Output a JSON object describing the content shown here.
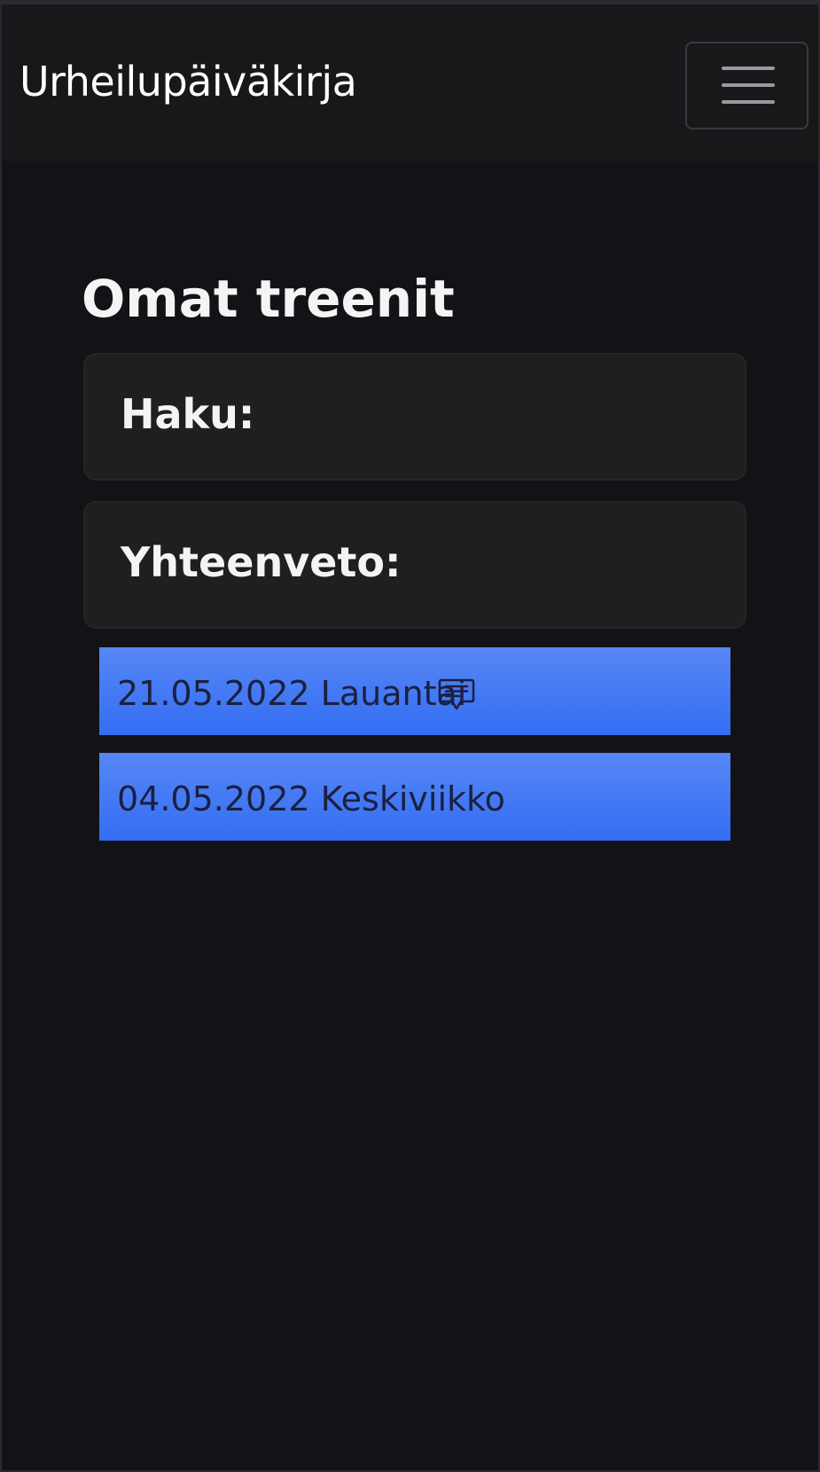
{
  "navbar": {
    "brand": "Urheilupäiväkirja",
    "toggler_icon": "hamburger-menu-icon"
  },
  "main": {
    "title": "Omat treenit",
    "search_card": {
      "title": "Haku:"
    },
    "summary_card": {
      "title": "Yhteenveto:"
    },
    "workouts": [
      {
        "label": "21.05.2022 Lauantai",
        "icon": "comment-icon",
        "has_comment": true
      },
      {
        "label": "04.05.2022 Keskiviikko",
        "has_comment": false
      }
    ]
  },
  "colors": {
    "background": "#121217",
    "navbar": "#18181b",
    "card": "#1f1f21",
    "workout_top": "#5787f5",
    "workout_bottom": "#336df2",
    "workout_text": "#1b2040"
  }
}
